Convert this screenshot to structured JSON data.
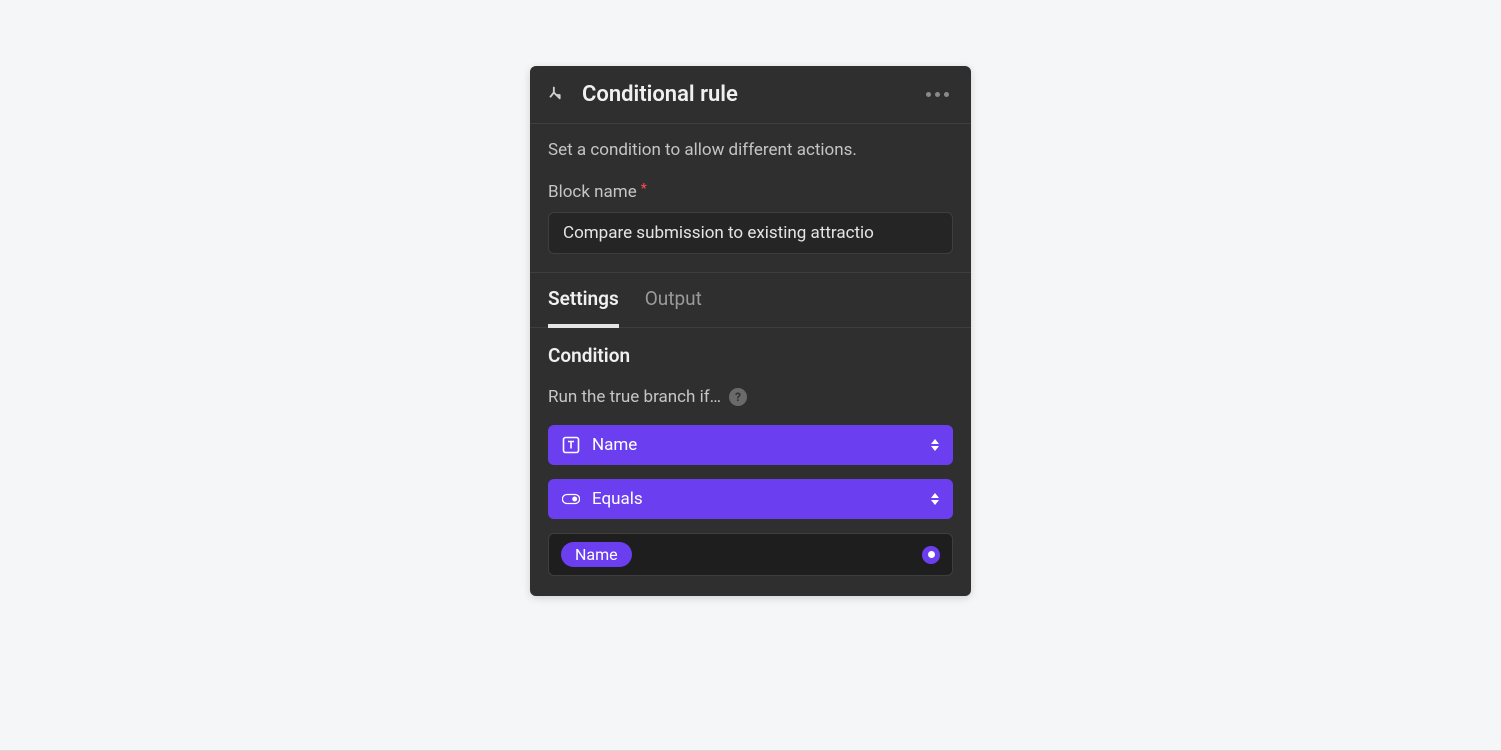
{
  "panel": {
    "title": "Conditional rule",
    "description": "Set a condition to allow different actions.",
    "block_name_label": "Block name",
    "block_name_value": "Compare submission to existing attractio"
  },
  "tabs": {
    "settings": "Settings",
    "output": "Output"
  },
  "condition": {
    "title": "Condition",
    "label": "Run the true branch if…",
    "field_select": "Name",
    "operator_select": "Equals",
    "value_chip": "Name"
  }
}
